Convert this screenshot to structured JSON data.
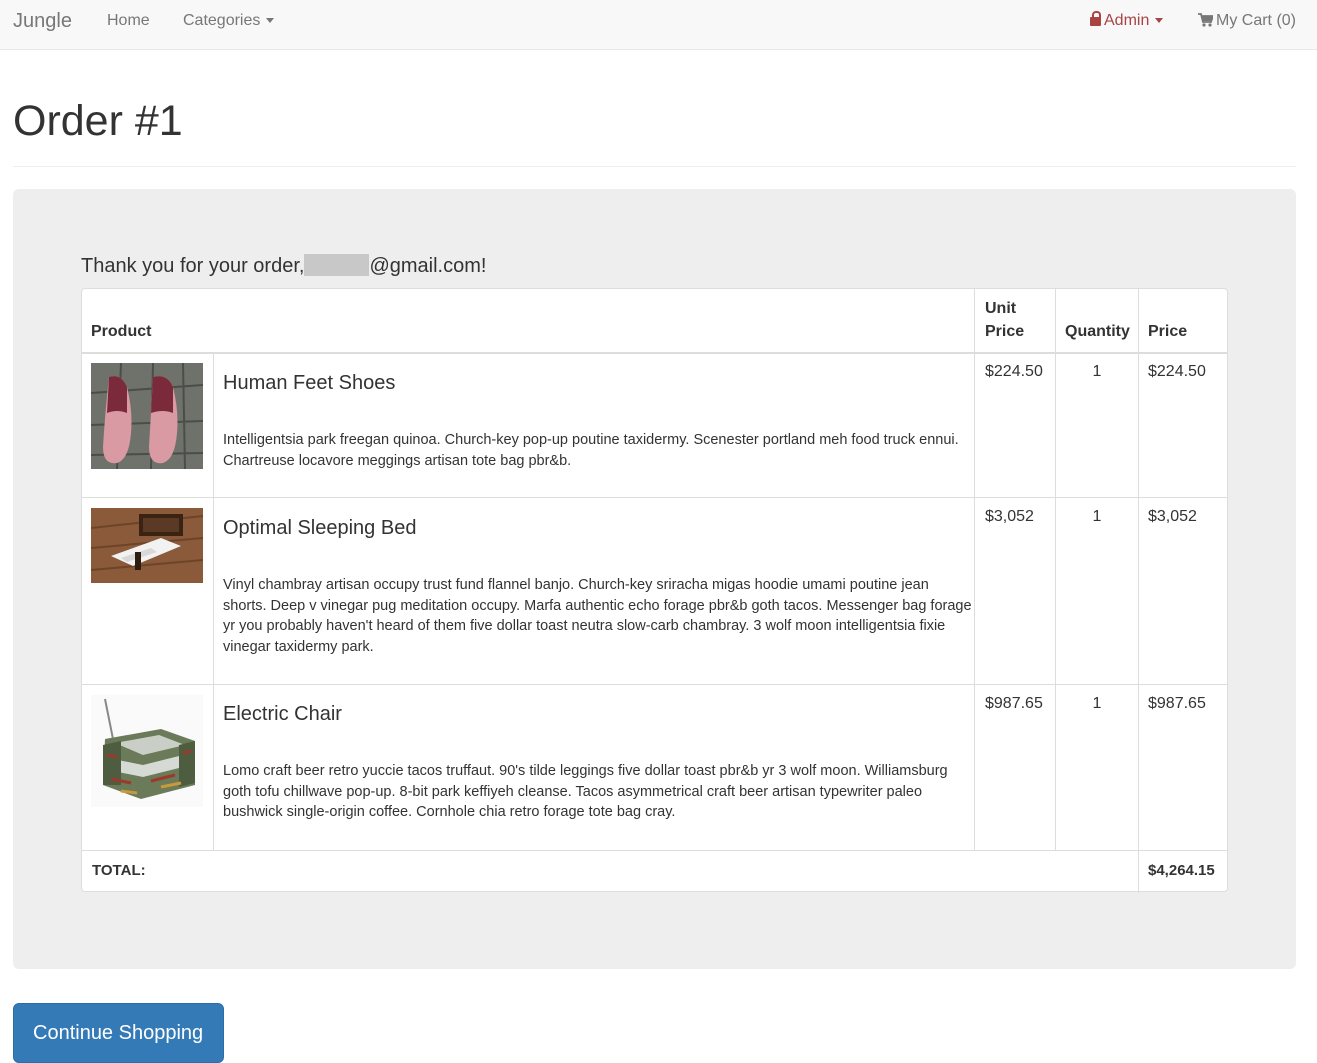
{
  "navbar": {
    "brand": "Jungle",
    "home": "Home",
    "categories": "Categories",
    "admin": "Admin",
    "cart": "My Cart (0)"
  },
  "page": {
    "title": "Order #1",
    "thanks_prefix": "Thank you for your order,",
    "thanks_suffix": "@gmail.com!",
    "continue_button": "Continue Shopping"
  },
  "table": {
    "headers": {
      "product": "Product",
      "unit_price_line1": "Unit",
      "unit_price_line2": "Price",
      "quantity": "Quantity",
      "price": "Price"
    },
    "items": [
      {
        "name": "Human Feet Shoes",
        "description": "Intelligentsia park freegan quinoa. Church-key pop-up poutine taxidermy. Scenester portland meh food truck ennui. Chartreuse locavore meggings artisan tote bag pbr&b.",
        "unit_price": "$224.50",
        "quantity": "1",
        "price": "$224.50",
        "image_icon": "shoes-photo"
      },
      {
        "name": "Optimal Sleeping Bed",
        "description": "Vinyl chambray artisan occupy trust fund flannel banjo. Church-key sriracha migas hoodie umami poutine jean shorts. Deep v vinegar pug meditation occupy. Marfa authentic echo forage pbr&b goth tacos. Messenger bag forage yr you probably haven't heard of them five dollar toast neutra slow-carb chambray. 3 wolf moon intelligentsia fixie vinegar taxidermy park.",
        "unit_price": "$3,052",
        "quantity": "1",
        "price": "$3,052",
        "image_icon": "bed-photo"
      },
      {
        "name": "Electric Chair",
        "description": "Lomo craft beer retro yuccie tacos truffaut. 90's tilde leggings five dollar toast pbr&b yr 3 wolf moon. Williamsburg goth tofu chillwave pop-up. 8-bit park keffiyeh cleanse. Tacos asymmetrical craft beer artisan typewriter paleo bushwick single-origin coffee. Cornhole chia retro forage tote bag cray.",
        "unit_price": "$987.65",
        "quantity": "1",
        "price": "$987.65",
        "image_icon": "chair-photo"
      }
    ],
    "total_label": "TOTAL:",
    "total_value": "$4,264.15"
  },
  "colors": {
    "accent": "#337ab7",
    "admin": "#a94442",
    "panel": "#eeeeee"
  }
}
